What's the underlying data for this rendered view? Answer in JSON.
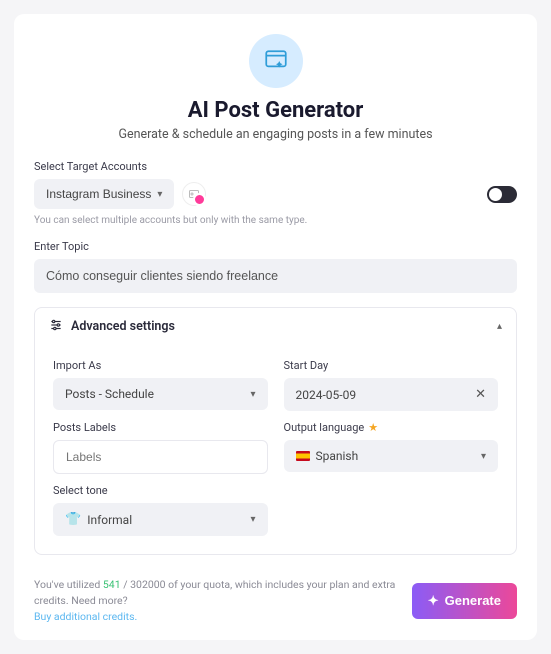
{
  "header": {
    "title": "AI Post Generator",
    "subtitle": "Generate & schedule an engaging posts in a few minutes"
  },
  "target": {
    "label": "Select Target Accounts",
    "selected": "Instagram Business",
    "helper": "You can select multiple accounts but only with the same type."
  },
  "topic": {
    "label": "Enter Topic",
    "value": "Cómo conseguir clientes siendo freelance"
  },
  "advanced": {
    "title": "Advanced settings",
    "import_as": {
      "label": "Import As",
      "value": "Posts - Schedule"
    },
    "start_day": {
      "label": "Start Day",
      "value": "2024-05-09"
    },
    "posts_labels": {
      "label": "Posts Labels",
      "placeholder": "Labels"
    },
    "output_lang": {
      "label": "Output language",
      "value": "Spanish"
    },
    "tone": {
      "label": "Select tone",
      "value": "Informal"
    }
  },
  "footer": {
    "quota_prefix": "You've utilized ",
    "quota_used": "541",
    "quota_sep": " / ",
    "quota_total": "302000",
    "quota_suffix": " of your quota, which includes your plan and extra credits. Need more?",
    "buy_link": "Buy additional credits.",
    "generate": "Generate"
  }
}
